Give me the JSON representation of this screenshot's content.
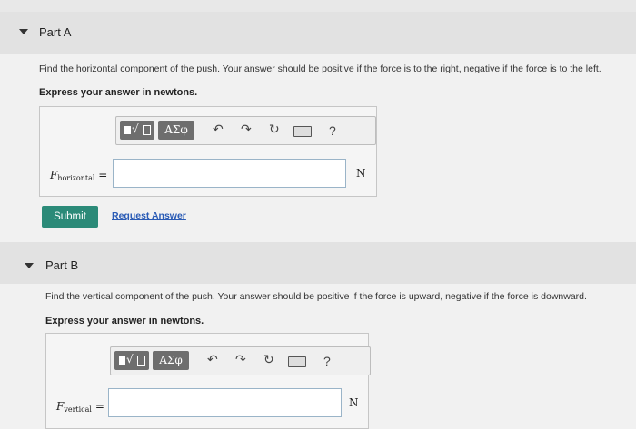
{
  "parts": [
    {
      "title": "Part A",
      "prompt": "Find the horizontal component of the push. Your answer should be positive if the force is to the right, negative if the force is to the left.",
      "instruction": "Express your answer in newtons.",
      "variable": {
        "symbol": "F",
        "subscript": "horizontal",
        "equals": "="
      },
      "input_value": "",
      "unit": "N",
      "submit_label": "Submit",
      "request_label": "Request Answer"
    },
    {
      "title": "Part B",
      "prompt": "Find the vertical component of the push. Your answer should be positive if the force is upward, negative if the force is downward.",
      "instruction": "Express your answer in newtons.",
      "variable": {
        "symbol": "F",
        "subscript": "vertical",
        "equals": "="
      },
      "input_value": "",
      "unit": "N"
    }
  ],
  "toolbar": {
    "templates_icon": "templates-radical-icon",
    "greek_label": "ΑΣφ",
    "undo_icon": "undo-icon",
    "redo_icon": "redo-icon",
    "reset_icon": "reset-icon",
    "keyboard_icon": "keyboard-icon",
    "help_label": "?"
  },
  "colors": {
    "submit": "#2b8a78",
    "link": "#2a5bb5",
    "toolbar_button": "#6e6e6e"
  }
}
